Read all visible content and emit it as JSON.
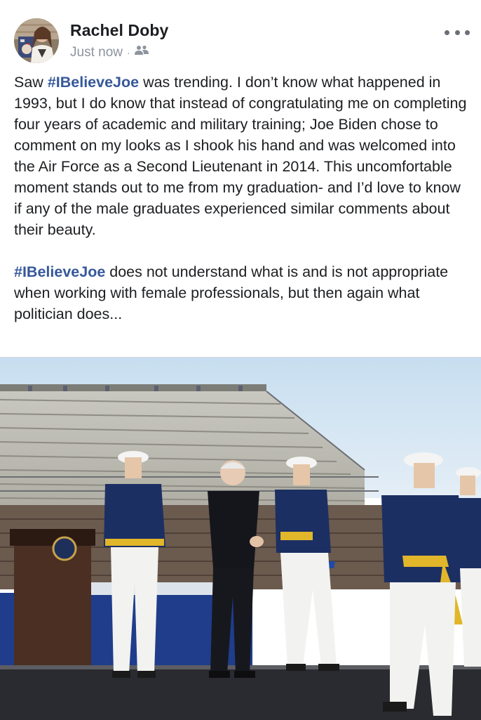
{
  "post": {
    "author": "Rachel Doby",
    "timestamp": "Just now",
    "separator": "·",
    "audience_icon": "friends-icon",
    "more_icon": "more-options-icon",
    "body": {
      "p1_before": "Saw ",
      "hashtag": "#IBelieveJoe",
      "p1_after": " was trending. I don’t know what happened in 1993, but I do know that instead of congratulating me on completing four years of academic and military training; Joe Biden chose to comment on my looks as I shook his hand and was welcomed into the Air Force as a Second Lieutenant in 2014.  This uncomfortable moment stands out to me from my graduation- and I’d love to know if any of the male graduates experienced similar comments about their beauty.",
      "p2_after": " does not understand what is and is not appropriate when working with female professionals, but then again what politician does..."
    }
  },
  "colors": {
    "hashtag": "#365899",
    "text": "#1c1e21",
    "meta": "#8d949e"
  }
}
